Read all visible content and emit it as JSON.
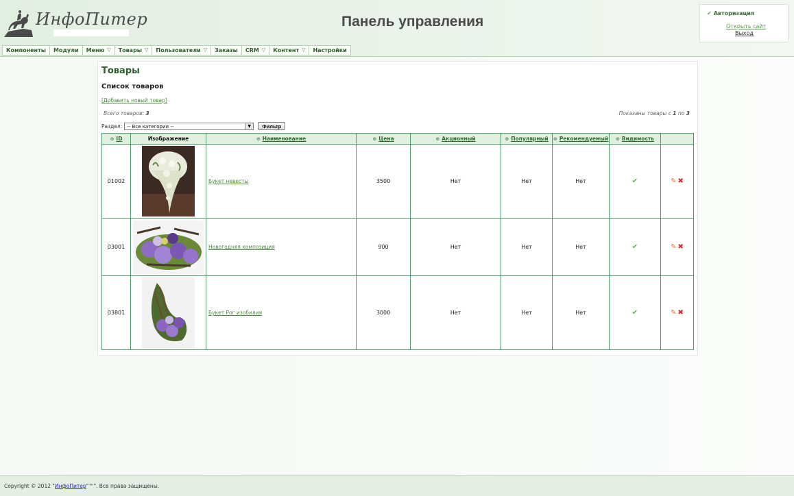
{
  "header": {
    "logo_text": "ИнфоПитер",
    "page_title": "Панель управления"
  },
  "auth": {
    "title": "Авторизация",
    "open_site": "Открыть сайт",
    "logout": "Выход"
  },
  "menu": [
    {
      "label": "Компоненты",
      "has_dropdown": false
    },
    {
      "label": "Модули",
      "has_dropdown": false
    },
    {
      "label": "Меню",
      "has_dropdown": true
    },
    {
      "label": "Товары",
      "has_dropdown": true
    },
    {
      "label": "Пользователи",
      "has_dropdown": true
    },
    {
      "label": "Заказы",
      "has_dropdown": false
    },
    {
      "label": "CRM",
      "has_dropdown": true
    },
    {
      "label": "Контент",
      "has_dropdown": true
    },
    {
      "label": "Настройки",
      "has_dropdown": false
    }
  ],
  "main": {
    "title": "Товары",
    "subtitle": "Список товаров",
    "add_link": "[Добавить новый товар]",
    "total_label": "Всего товаров:",
    "total_count": "3",
    "shown_prefix": "Показаны товары с",
    "shown_from": "1",
    "shown_mid": "по",
    "shown_to": "3",
    "section_label": "Раздел:",
    "category_selected": "-- Все категории --",
    "filter_button": "Фильтр"
  },
  "table": {
    "columns": [
      {
        "label": "ID",
        "sortable": true
      },
      {
        "label": "Изображение",
        "sortable": false
      },
      {
        "label": "Наименование",
        "sortable": true
      },
      {
        "label": "Цена",
        "sortable": true
      },
      {
        "label": "Акционный",
        "sortable": true
      },
      {
        "label": "Популярный",
        "sortable": true
      },
      {
        "label": "Рекомендуемый",
        "sortable": true
      },
      {
        "label": "Видимость",
        "sortable": true
      },
      {
        "label": "",
        "sortable": false
      }
    ],
    "rows": [
      {
        "id": "01002",
        "image": "bridal-bouquet",
        "name": "Букет невесты",
        "price": "3500",
        "promo": "Нет",
        "popular": "Нет",
        "recommended": "Нет",
        "visible": true
      },
      {
        "id": "03001",
        "image": "new-year-composition",
        "name": "Новогодняя композиция",
        "price": "900",
        "promo": "Нет",
        "popular": "Нет",
        "recommended": "Нет",
        "visible": true
      },
      {
        "id": "03801",
        "image": "horn-of-plenty-bouquet",
        "name": "Букет Рог изобилия",
        "price": "3000",
        "promo": "Нет",
        "popular": "Нет",
        "recommended": "Нет",
        "visible": true
      }
    ]
  },
  "footer": {
    "prefix": "Copyright © 2012 \"",
    "brand": "ИнфоПитер",
    "suffix": "\"™\". Все права защищены."
  },
  "colors": {
    "accent": "#2e5b2e",
    "table_border": "#4f9b6e",
    "header_bg": "#e1efe0"
  }
}
